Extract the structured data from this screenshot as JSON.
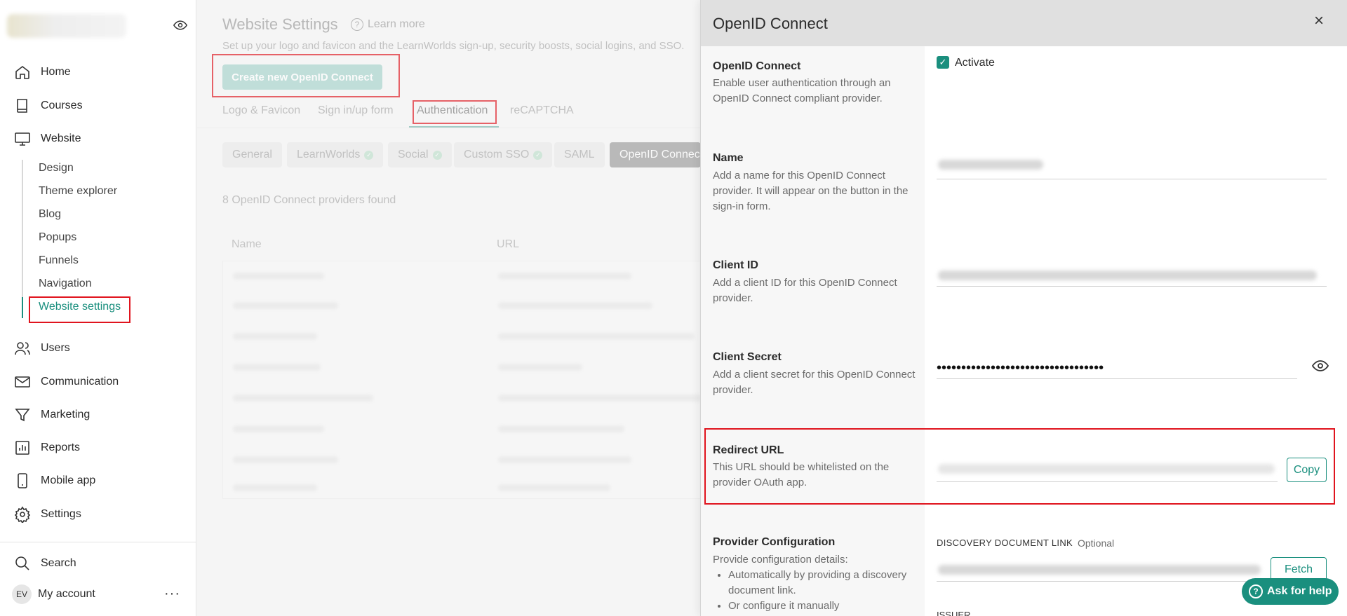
{
  "sidebar": {
    "nav": [
      {
        "label": "Home",
        "icon": "home-icon"
      },
      {
        "label": "Courses",
        "icon": "book-icon"
      },
      {
        "label": "Website",
        "icon": "monitor-icon"
      }
    ],
    "website_sub": [
      "Design",
      "Theme explorer",
      "Blog",
      "Popups",
      "Funnels",
      "Navigation",
      "Website settings"
    ],
    "nav_bottom": [
      {
        "label": "Users",
        "icon": "users-icon"
      },
      {
        "label": "Communication",
        "icon": "mail-icon"
      },
      {
        "label": "Marketing",
        "icon": "filter-icon"
      },
      {
        "label": "Reports",
        "icon": "chart-icon"
      },
      {
        "label": "Mobile app",
        "icon": "phone-icon"
      },
      {
        "label": "Settings",
        "icon": "gear-icon"
      }
    ],
    "search_label": "Search",
    "account_initials": "EV",
    "account_label": "My account",
    "more_label": "···"
  },
  "main": {
    "title": "Website Settings",
    "learn_more": "Learn more",
    "subtitle": "Set up your logo and favicon and the LearnWorlds sign-up, security boosts, social logins, and SSO.",
    "create_button": "Create new OpenID Connect",
    "tabs": [
      "Logo & Favicon",
      "Sign in/up form",
      "Authentication",
      "reCAPTCHA"
    ],
    "pills": [
      "General",
      "LearnWorlds",
      "Social",
      "Custom SSO",
      "SAML",
      "OpenID Connect"
    ],
    "providers_found": "8 OpenID Connect providers found",
    "table_headers": [
      "Name",
      "URL"
    ]
  },
  "drawer": {
    "title": "OpenID Connect",
    "close": "×",
    "fields": {
      "openid": {
        "title": "OpenID Connect",
        "desc": "Enable user authentication through an OpenID Connect compliant provider.",
        "checkbox_label": "Activate"
      },
      "name": {
        "title": "Name",
        "desc": "Add a name for this OpenID Connect provider. It will appear on the button in the sign-in form."
      },
      "client_id": {
        "title": "Client ID",
        "desc": "Add a client ID for this OpenID Connect provider."
      },
      "client_secret": {
        "title": "Client Secret",
        "desc": "Add a client secret for this OpenID Connect provider.",
        "value": "••••••••••••••••••••••••••••••••••"
      },
      "redirect": {
        "title": "Redirect URL",
        "desc": "This URL should be whitelisted on the provider OAuth app.",
        "copy_button": "Copy"
      },
      "provider": {
        "title": "Provider Configuration",
        "desc": "Provide configuration details:",
        "bullets": [
          "Automatically by providing a discovery document link.",
          "Or configure it manually"
        ],
        "discovery_label": "DISCOVERY DOCUMENT LINK",
        "optional": "Optional",
        "fetch_button": "Fetch",
        "issuer_label": "ISSUER"
      }
    }
  },
  "help_button": "Ask for help",
  "colors": {
    "accent": "#1a8f7e",
    "highlight": "#e0141e"
  }
}
